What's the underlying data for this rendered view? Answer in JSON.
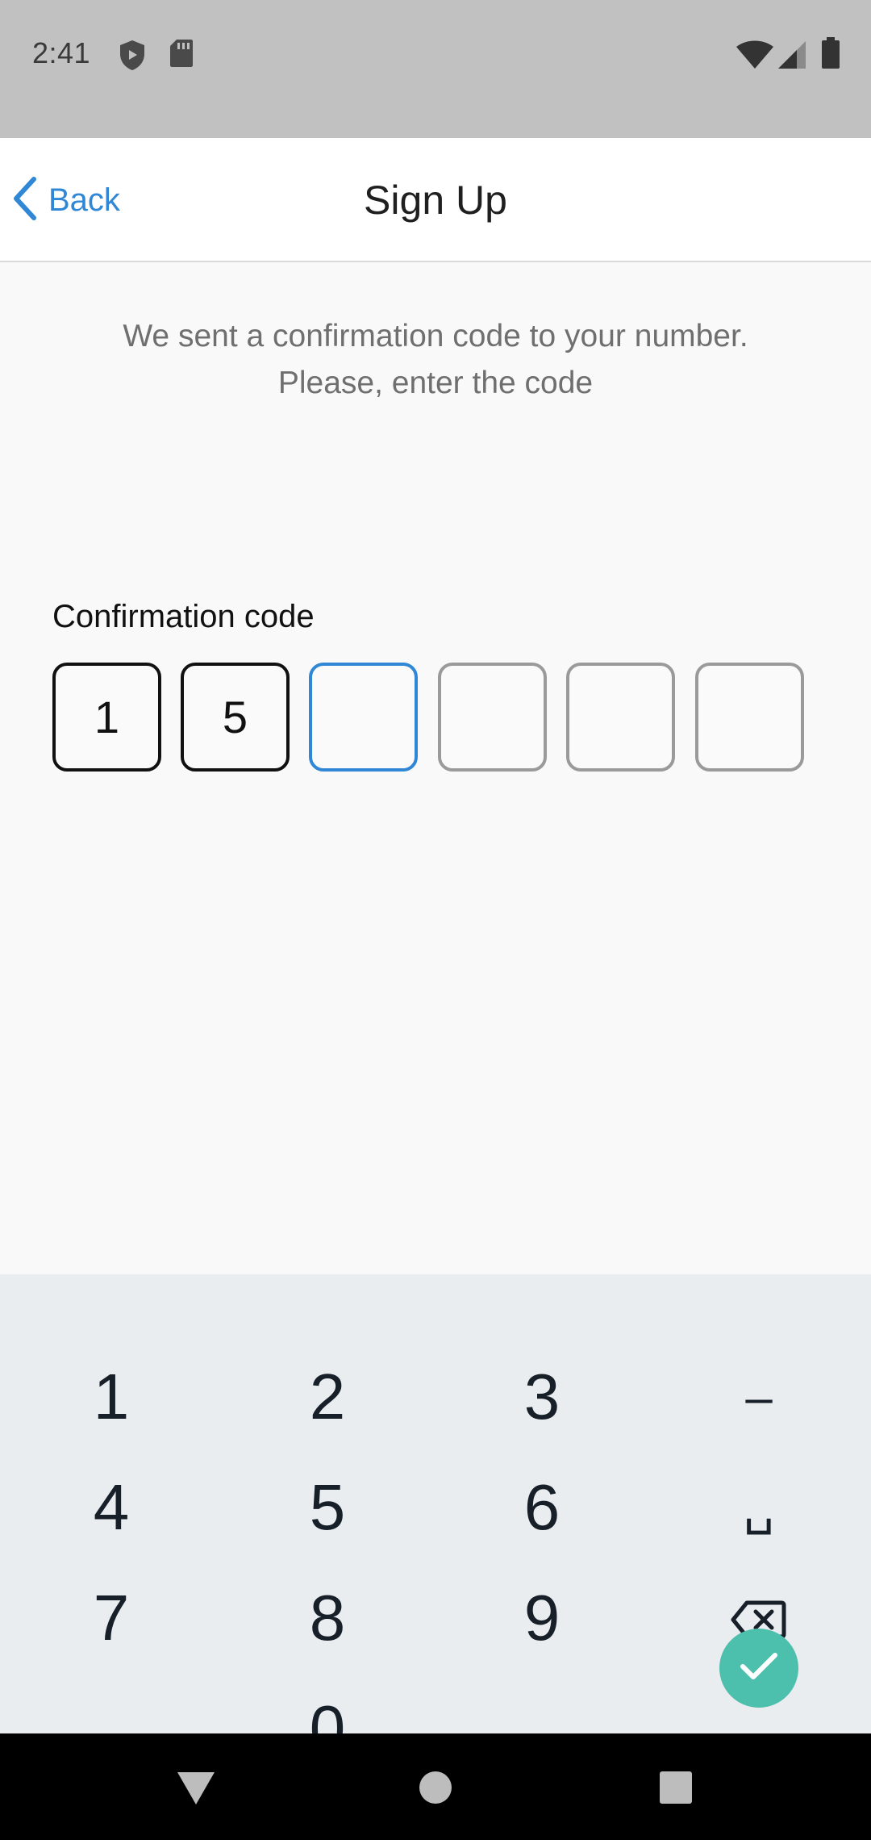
{
  "status_bar": {
    "time": "2:41"
  },
  "header": {
    "back_label": "Back",
    "title": "Sign Up"
  },
  "instructions": {
    "line1": "We sent a confirmation code to your number.",
    "line2": "Please, enter the code"
  },
  "code": {
    "label": "Confirmation code",
    "digits": [
      "1",
      "5",
      "",
      "",
      "",
      ""
    ],
    "active_index": 2
  },
  "keypad": {
    "rows": [
      [
        "1",
        "2",
        "3",
        "–"
      ],
      [
        "4",
        "5",
        "6",
        "␣"
      ],
      [
        "7",
        "8",
        "9",
        "backspace"
      ],
      [
        ",",
        "0",
        ".",
        "done"
      ]
    ]
  },
  "colors": {
    "accent": "#2f87d6",
    "done_button": "#4dbfad",
    "keypad_bg": "#eaedf0"
  }
}
